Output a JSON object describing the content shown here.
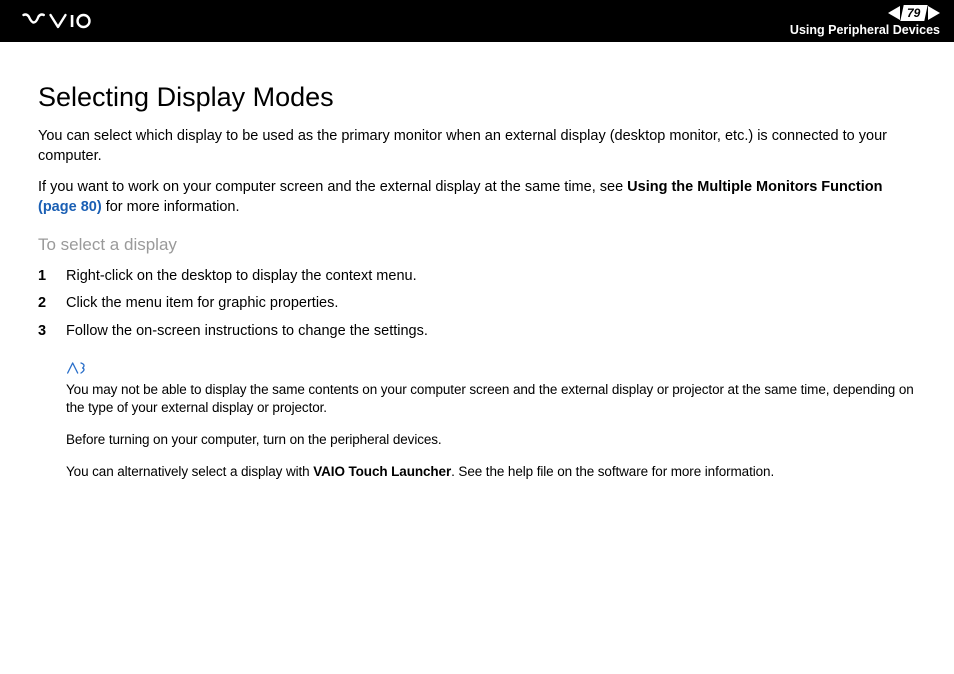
{
  "header": {
    "page_number": "79",
    "section": "Using Peripheral Devices"
  },
  "title": "Selecting Display Modes",
  "intro1": "You can select which display to be used as the primary monitor when an external display (desktop monitor, etc.) is connected to your computer.",
  "intro2_a": "If you want to work on your computer screen and the external display at the same time, see ",
  "intro2_bold": "Using the Multiple Monitors Function",
  "intro2_link": " (page 80)",
  "intro2_b": " for more information.",
  "subhead": "To select a display",
  "steps": [
    "Right-click on the desktop to display the context menu.",
    "Click the menu item for graphic properties.",
    "Follow the on-screen instructions to change the settings."
  ],
  "note1": "You may not be able to display the same contents on your computer screen and the external display or projector at the same time, depending on the type of your external display or projector.",
  "note2": "Before turning on your computer, turn on the peripheral devices.",
  "note3_a": "You can alternatively select a display with ",
  "note3_bold": "VAIO Touch Launcher",
  "note3_b": ". See the help file on the software for more information."
}
